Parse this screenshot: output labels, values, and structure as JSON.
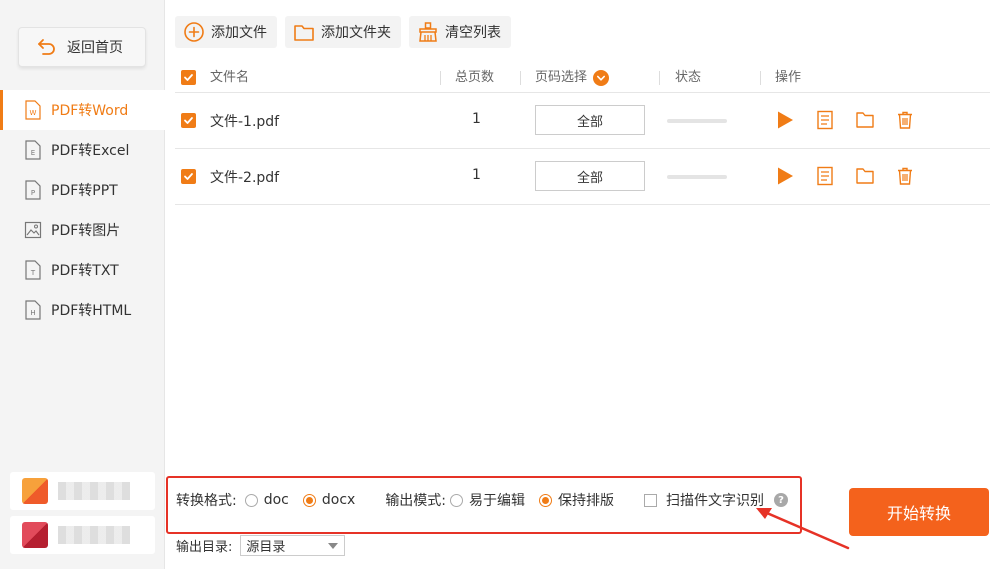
{
  "sidebar": {
    "back_label": "返回首页",
    "items": [
      {
        "label": "PDF转Word",
        "letter": "W",
        "active": true
      },
      {
        "label": "PDF转Excel",
        "letter": "E",
        "active": false
      },
      {
        "label": "PDF转PPT",
        "letter": "P",
        "active": false
      },
      {
        "label": "PDF转图片",
        "letter": "",
        "active": false
      },
      {
        "label": "PDF转TXT",
        "letter": "T",
        "active": false
      },
      {
        "label": "PDF转HTML",
        "letter": "H",
        "active": false
      }
    ]
  },
  "toolbar": {
    "add_file": "添加文件",
    "add_folder": "添加文件夹",
    "clear_list": "清空列表"
  },
  "table": {
    "headers": {
      "name": "文件名",
      "pages": "总页数",
      "page_select": "页码选择",
      "status": "状态",
      "actions": "操作"
    },
    "rows": [
      {
        "name": "文件-1.pdf",
        "pages": "1",
        "page_select": "全部"
      },
      {
        "name": "文件-2.pdf",
        "pages": "1",
        "page_select": "全部"
      }
    ]
  },
  "options": {
    "format_label": "转换格式:",
    "format_doc": "doc",
    "format_docx": "docx",
    "format_selected": "docx",
    "mode_label": "输出模式:",
    "mode_edit": "易于编辑",
    "mode_layout": "保持排版",
    "mode_selected": "保持排版",
    "ocr_label": "扫描件文字识别",
    "ocr_checked": false,
    "help": "?",
    "output_label": "输出目录:",
    "output_value": "源目录"
  },
  "start_button": "开始转换",
  "colors": {
    "accent": "#f07c16",
    "start": "#f4621c",
    "highlight": "#e63226"
  }
}
